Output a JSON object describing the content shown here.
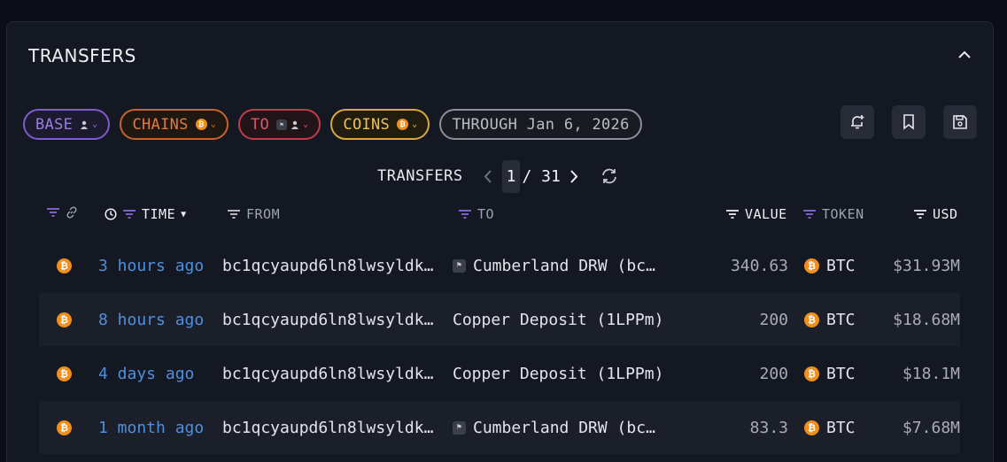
{
  "panel": {
    "title": "TRANSFERS"
  },
  "filters": {
    "base": "BASE",
    "chains": "CHAINS",
    "to": "TO",
    "coins": "COINS",
    "through": "THROUGH Jan 6, 2026"
  },
  "pager": {
    "label": "TRANSFERS",
    "page": "1",
    "total": "/ 31"
  },
  "columns": {
    "time": "TIME",
    "from": "FROM",
    "to": "TO",
    "value": "VALUE",
    "token": "TOKEN",
    "usd": "USD"
  },
  "rows": [
    {
      "time": "3 hours ago",
      "from": "bc1qcyaupd6ln8lwsyldk…",
      "to": "Cumberland DRW (bc…",
      "to_has_icon": true,
      "value": "340.63",
      "token": "BTC",
      "usd": "$31.93M"
    },
    {
      "time": "8 hours ago",
      "from": "bc1qcyaupd6ln8lwsyldk…",
      "to": "Copper Deposit (1LPPm)",
      "to_has_icon": false,
      "value": "200",
      "token": "BTC",
      "usd": "$18.68M"
    },
    {
      "time": "4 days ago",
      "from": "bc1qcyaupd6ln8lwsyldk…",
      "to": "Copper Deposit (1LPPm)",
      "to_has_icon": false,
      "value": "200",
      "token": "BTC",
      "usd": "$18.1M"
    },
    {
      "time": "1 month ago",
      "from": "bc1qcyaupd6ln8lwsyldk…",
      "to": "Cumberland DRW (bc…",
      "to_has_icon": true,
      "value": "83.3",
      "token": "BTC",
      "usd": "$7.68M"
    }
  ],
  "colors": {
    "time_link": "#4f8fe0",
    "btc": "#f08f1b",
    "filter_purple": "#7d5ccf"
  }
}
